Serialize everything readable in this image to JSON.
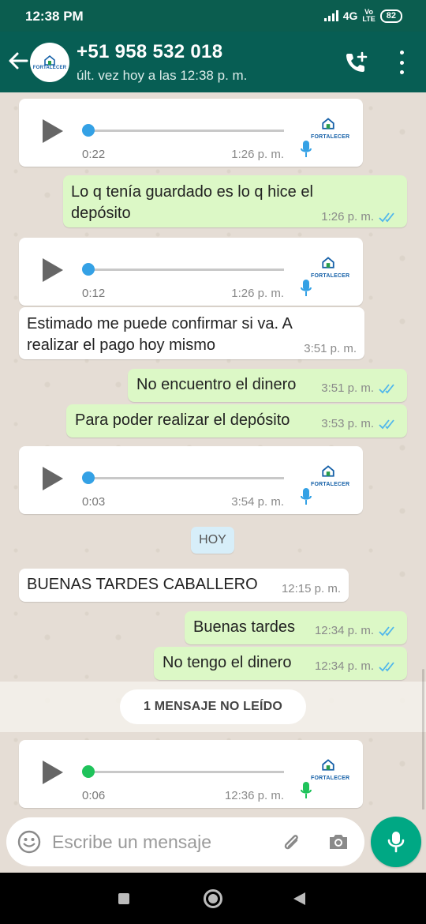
{
  "status_bar": {
    "time": "12:38 PM",
    "network": "4G",
    "volte_top": "Vo",
    "volte_bottom": "LTE",
    "battery": "82"
  },
  "header": {
    "contact_name": "+51 958 532 018",
    "last_seen": "últ. vez hoy a las 12:38 p. m.",
    "avatar_text": "FORTALECER"
  },
  "messages": [
    {
      "type": "voice",
      "direction": "in",
      "duration": "0:22",
      "time": "1:26 p. m.",
      "logo_text": "FORTALECER"
    },
    {
      "type": "text",
      "direction": "out",
      "text": "Lo q tenía guardado es lo q hice el depósito",
      "time": "1:26 p. m."
    },
    {
      "type": "voice",
      "direction": "in",
      "duration": "0:12",
      "time": "1:26 p. m.",
      "logo_text": "FORTALECER"
    },
    {
      "type": "text",
      "direction": "in",
      "text": "Estimado me puede confirmar si va. A realizar el pago hoy mismo",
      "time": "3:51 p. m."
    },
    {
      "type": "text",
      "direction": "out",
      "text": "No encuentro el dinero",
      "time": "3:51 p. m."
    },
    {
      "type": "text",
      "direction": "out",
      "text": "Para poder realizar el depósito",
      "time": "3:53 p. m."
    },
    {
      "type": "voice",
      "direction": "in",
      "duration": "0:03",
      "time": "3:54 p. m.",
      "logo_text": "FORTALECER"
    },
    {
      "type": "date",
      "text": "HOY"
    },
    {
      "type": "text",
      "direction": "in",
      "text": "BUENAS TARDES CABALLERO",
      "time": "12:15 p. m."
    },
    {
      "type": "text",
      "direction": "out",
      "text": "Buenas tardes",
      "time": "12:34 p. m."
    },
    {
      "type": "text",
      "direction": "out",
      "text": "No tengo el dinero",
      "time": "12:34 p. m."
    },
    {
      "type": "unread",
      "text": "1 MENSAJE NO LEÍDO"
    },
    {
      "type": "voice",
      "direction": "in",
      "duration": "0:06",
      "time": "12:36 p. m.",
      "logo_text": "FORTALECER",
      "unplayed": true
    }
  ],
  "input": {
    "placeholder": "Escribe un mensaje"
  },
  "colors": {
    "header": "#075e54",
    "status_bar": "#0b5d4f",
    "outgoing_bubble": "#dcf8c6",
    "incoming_bubble": "#ffffff",
    "accent": "#00a884",
    "read_ticks": "#4fb6ec",
    "voice_played": "#34a1e5",
    "voice_unplayed": "#1fc35b"
  },
  "icons": [
    "back-arrow-icon",
    "add-call-icon",
    "menu-dots-icon",
    "play-icon",
    "mic-icon",
    "double-tick-icon",
    "emoji-icon",
    "attach-icon",
    "camera-icon"
  ]
}
